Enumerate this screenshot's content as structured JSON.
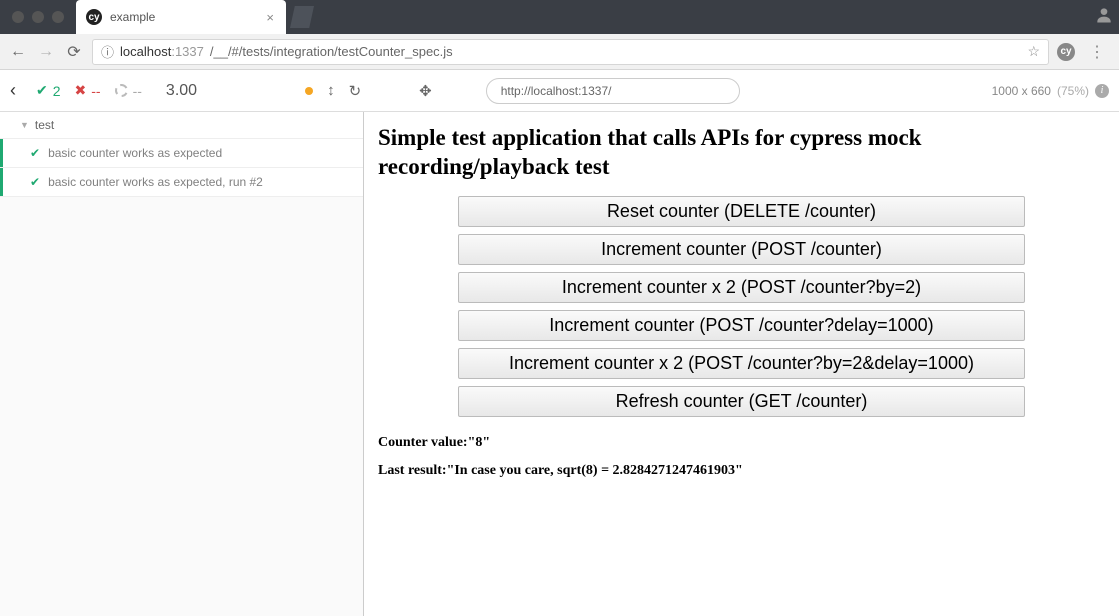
{
  "browser": {
    "tab_title": "example",
    "omnibox": {
      "host_prefix": "localhost",
      "host_suffix": ":1337",
      "path": "/__/#/tests/integration/testCounter_spec.js"
    }
  },
  "runner_header": {
    "passed": "2",
    "failed": "--",
    "pending": "--",
    "duration": "3.00",
    "url": "http://localhost:1337/",
    "viewport_dim": "1000 x 660",
    "viewport_scale": "(75%)"
  },
  "test_panel": {
    "suite": "test",
    "tests": [
      "basic counter works as expected",
      "basic counter works as expected, run #2"
    ]
  },
  "aut": {
    "heading": "Simple test application that calls APIs for cypress mock recording/playback test",
    "buttons": [
      "Reset counter (DELETE /counter)",
      "Increment counter (POST /counter)",
      "Increment counter x 2 (POST /counter?by=2)",
      "Increment counter (POST /counter?delay=1000)",
      "Increment counter x 2 (POST /counter?by=2&delay=1000)",
      "Refresh counter (GET /counter)"
    ],
    "counter_label": "Counter value:",
    "counter_value": "\"8\"",
    "last_result_label": "Last result:",
    "last_result_value": "\"In case you care, sqrt(8) = 2.8284271247461903\""
  }
}
